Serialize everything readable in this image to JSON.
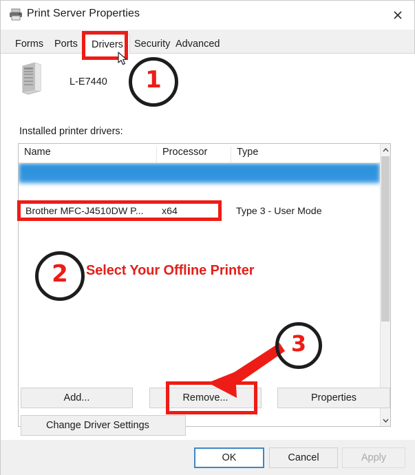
{
  "window": {
    "title": "Print Server Properties",
    "title_icon": "printer-icon",
    "close_label": "✕"
  },
  "tabs": [
    {
      "label": "Forms",
      "active": false
    },
    {
      "label": "Ports",
      "active": false
    },
    {
      "label": "Drivers",
      "active": true
    },
    {
      "label": "Security",
      "active": false
    },
    {
      "label": "Advanced",
      "active": false
    }
  ],
  "panel": {
    "server_icon": "server-tower-icon",
    "server_name": "L-E7440",
    "list_label": "Installed printer drivers:"
  },
  "list": {
    "columns": [
      "Name",
      "Processor",
      "Type"
    ],
    "rows": [
      {
        "name": "",
        "processor": "",
        "type": "",
        "state": "selected"
      },
      {
        "name": "",
        "processor": "",
        "type": "",
        "state": "blurred"
      },
      {
        "name": "Brother MFC-J4510DW P...",
        "processor": "x64",
        "type": "Type 3 - User Mode",
        "state": "normal"
      },
      {
        "name": "",
        "processor": "",
        "type": "",
        "state": "blurred"
      },
      {
        "name": "",
        "processor": "",
        "type": "",
        "state": "blurred"
      },
      {
        "name": "",
        "processor": "",
        "type": "",
        "state": "blurred"
      },
      {
        "name": "",
        "processor": "",
        "type": "",
        "state": "blurred"
      },
      {
        "name": "",
        "processor": "",
        "type": "",
        "state": "blurred"
      },
      {
        "name": "",
        "processor": "",
        "type": "",
        "state": "blurred"
      },
      {
        "name": "",
        "processor": "",
        "type": "",
        "state": "blurred"
      },
      {
        "name": "",
        "processor": "",
        "type": "",
        "state": "blurred"
      },
      {
        "name": "",
        "processor": "",
        "type": "",
        "state": "blurred"
      }
    ],
    "scroll": {
      "up_arrow": "⌃",
      "down_arrow": "⌄"
    }
  },
  "buttons": {
    "add": "Add...",
    "remove": "Remove...",
    "properties": "Properties",
    "change_driver_settings": "Change Driver Settings",
    "shield_icon": "uac-shield-icon"
  },
  "footer": {
    "ok": "OK",
    "cancel": "Cancel",
    "apply": "Apply"
  },
  "annotations": {
    "step1": "1",
    "step2": "2",
    "step3": "3",
    "step2_text": "Select Your Offline Printer",
    "highlight_color": "#ee1c16",
    "circle_color": "#1d1d1d",
    "number_color": "#ee1c16"
  }
}
